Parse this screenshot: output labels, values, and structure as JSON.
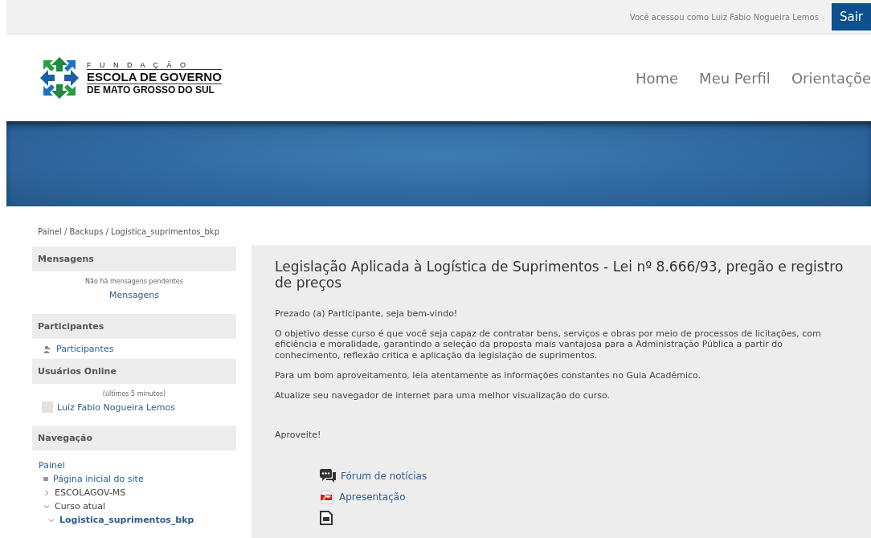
{
  "top_bar": {
    "logged_in_text": "Você acessou como Luiz Fabio Nogueira Lemos",
    "logout_button": "Sair"
  },
  "logo": {
    "line_1": "F U N D A Ç Ã O",
    "line_2": "ESCOLA DE GOVERNO",
    "line_3": "DE MATO GROSSO DO SUL"
  },
  "nav": [
    "Home",
    "Meu Perfil",
    "Orientaçõe"
  ],
  "breadcrumb": "Painel / Backups / Logistica_suprimentos_bkp",
  "sidebar": {
    "messages": {
      "title": "Mensagens",
      "note": "Não há mensagens pendentes",
      "link": "Mensagens"
    },
    "participants": {
      "title": "Participantes",
      "link": "Participantes"
    },
    "online": {
      "title": "Usuários Online",
      "note": "(últimos 5 minutos)",
      "users": [
        "Luiz Fabio Nogueira Lemos"
      ]
    },
    "navigation": {
      "title": "Navegação",
      "root": "Painel",
      "items": [
        {
          "label": "Página inicial do site",
          "kind": "leaf"
        },
        {
          "label": "ESCOLAGOV-MS",
          "kind": "branch",
          "expanded": false
        },
        {
          "label": "Curso atual",
          "kind": "branch",
          "expanded": true,
          "children": [
            {
              "label": "Logistica_suprimentos_bkp",
              "kind": "branch",
              "expanded": true,
              "current": true
            }
          ]
        }
      ]
    }
  },
  "main": {
    "title": "Legislação Aplicada à Logística de Suprimentos - Lei nº 8.666/93, pregão e registro de preços",
    "paragraphs": [
      "Prezado (a) Participante, seja bem-vindo!",
      "O objetivo desse curso é que você seja capaz de contratar bens, serviços e obras por meio de processos de licitações, com eficiência e moralidade, garantindo a seleção da proposta mais vantajosa para a Administração Pública a partir do conhecimento, reflexão critica e aplicação da legislação de suprimentos.",
      "Para um bom aproveitamento, leia atentamente as informações constantes no Guia Acadêmico.",
      "Atualize seu navegador de internet para uma melhor visualização do curso."
    ],
    "closing": "Aproveite!",
    "resources": [
      {
        "kind": "forum",
        "label": "Fórum de notícias"
      },
      {
        "kind": "pdf",
        "label": "Apresentação"
      },
      {
        "kind": "file"
      }
    ]
  }
}
